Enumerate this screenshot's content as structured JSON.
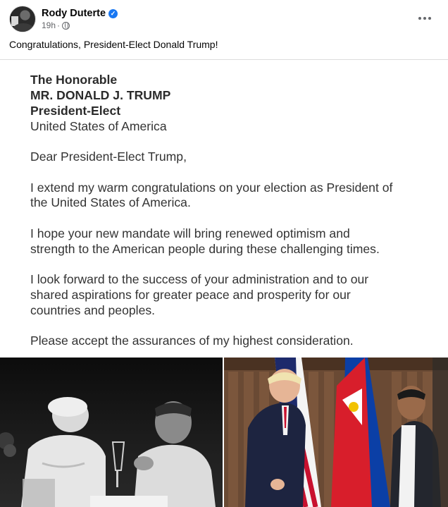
{
  "post": {
    "author": "Rody Duterte",
    "time": "19h",
    "dot": "·",
    "caption": "Congratulations, President-Elect Donald Trump!"
  },
  "letter": {
    "lines": [
      "The Honorable",
      "MR. DONALD J. TRUMP",
      "President-Elect",
      "United States of America",
      "Dear President-Elect Trump,",
      "I extend my warm congratulations on your election as President of",
      "the United States of America.",
      "I hope your new mandate will bring renewed optimism and",
      "strength to the American people during these challenging times.",
      "I look forward to the success of your administration and to our",
      "shared aspirations for greater peace and prosperity for our",
      "countries and peoples.",
      "Please accept the assurances of my highest consideration."
    ]
  },
  "icons": {
    "verified": "verified-badge-icon",
    "privacy": "globe-icon",
    "more": "more-options-icon"
  },
  "colors": {
    "accent": "#1877f2",
    "meta": "#65676b"
  }
}
